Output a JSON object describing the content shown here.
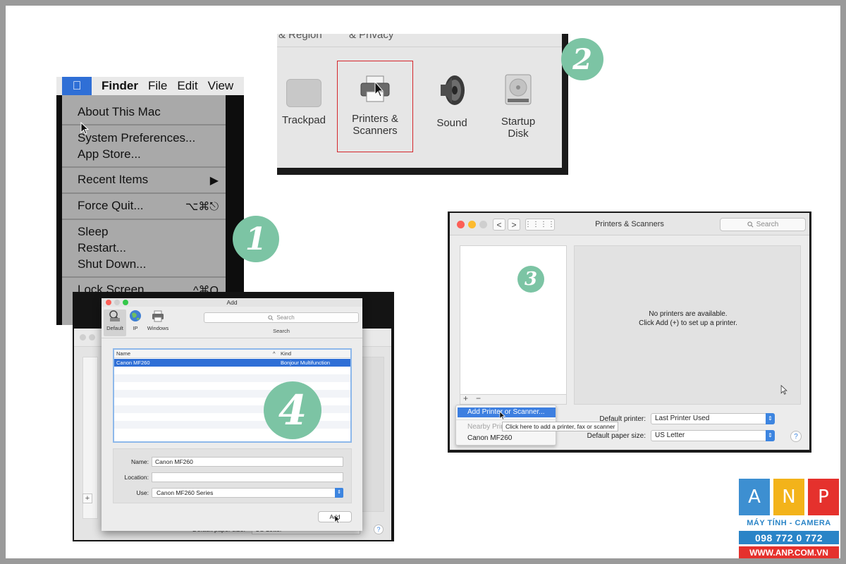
{
  "colors": {
    "badge": "#7cc4a4",
    "highlight_border": "#d4262b",
    "mac_blue": "#3d85e0",
    "logo_blue": "#2a84c7",
    "logo_red": "#e5312d"
  },
  "step1": {
    "badge": "1",
    "menubar": {
      "apple_icon": "apple-icon",
      "items": [
        "Finder",
        "File",
        "Edit",
        "View"
      ]
    },
    "menu": {
      "about": "About This Mac",
      "system_prefs": "System Preferences...",
      "app_store": "App Store...",
      "recent_items": "Recent Items",
      "recent_arrow": "▶",
      "force_quit": "Force Quit...",
      "force_quit_shortcut": "⌥⌘⎋",
      "sleep": "Sleep",
      "restart": "Restart...",
      "shut_down": "Shut Down...",
      "lock_screen": "Lock Screen",
      "lock_shortcut": "^⌘Q"
    }
  },
  "step2": {
    "badge": "2",
    "top_row": [
      "& Region",
      "& Privacy"
    ],
    "prefs": {
      "trackpad": "Trackpad",
      "printers_line1": "Printers &",
      "printers_line2": "Scanners",
      "sound": "Sound",
      "startup_line1": "Startup",
      "startup_line2": "Disk"
    }
  },
  "step3": {
    "badge": "3",
    "title": "Printers & Scanners",
    "search_placeholder": "Search",
    "nav_back": "<",
    "nav_forward": ">",
    "grid_icon": "⋮⋮⋮⋮",
    "no_printers_line1": "No printers are available.",
    "no_printers_line2": "Click Add (+) to set up a printer.",
    "plus": "+",
    "minus": "−",
    "default_printer_label": "Default printer:",
    "default_printer_value": "Last Printer Used",
    "paper_size_label": "Default paper size:",
    "paper_size_value": "US Letter",
    "help": "?",
    "dropdown": {
      "add": "Add Printer or Scanner...",
      "nearby_header": "Nearby Printers",
      "nearby_item": "Canon MF260"
    },
    "tooltip": "Click here to add a printer, fax or scanner"
  },
  "step4": {
    "badge": "4",
    "dialog_title": "Add",
    "toolbar": {
      "default": "Default",
      "ip": "IP",
      "windows": "Windows"
    },
    "search_placeholder": "Search",
    "search_label": "Search",
    "table": {
      "col_name": "Name",
      "col_kind": "Kind",
      "sort_arrow": "^",
      "rows": [
        {
          "name": "Canon MF260",
          "kind": "Bonjour Multifunction"
        }
      ]
    },
    "form": {
      "name_label": "Name:",
      "name_value": "Canon MF260",
      "location_label": "Location:",
      "location_value": "",
      "use_label": "Use:",
      "use_value": "Canon MF260 Series"
    },
    "add_button": "Add",
    "bg_plus": "+",
    "bg_paper_label": "Default paper size:",
    "bg_paper_value": "US Letter",
    "bg_help": "?"
  },
  "logo": {
    "letters": [
      "A",
      "N",
      "P"
    ],
    "tagline": "MÁY TÍNH - CAMERA",
    "phone": "098 772 0 772",
    "website": "WWW.ANP.COM.VN"
  }
}
